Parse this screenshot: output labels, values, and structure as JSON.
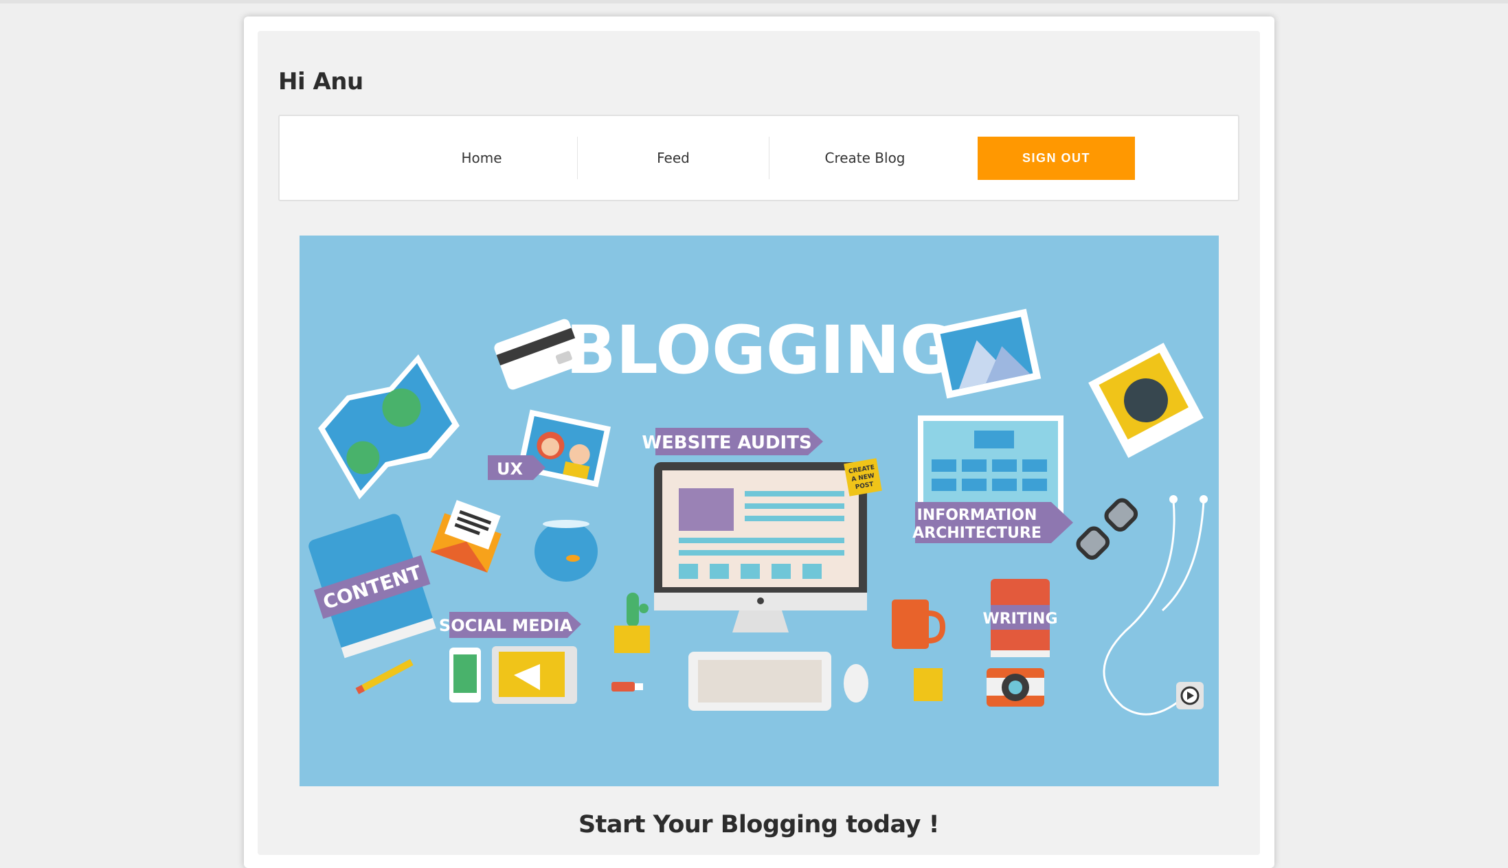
{
  "greeting": "Hi Anu",
  "nav": {
    "home": "Home",
    "feed": "Feed",
    "create_blog": "Create Blog",
    "sign_out": "SIGN OUT"
  },
  "hero": {
    "title": "BLOGGING",
    "labels": {
      "website_audits": "WEBSITE AUDITS",
      "ux": "UX",
      "content": "CONTENT",
      "social_media": "SOCIAL MEDIA",
      "information": "INFORMATION",
      "architecture": "ARCHITECTURE",
      "writing": "WRITING",
      "sticky_line1": "CREATE",
      "sticky_line2": "A NEW",
      "sticky_line3": "POST"
    }
  },
  "tagline": "Start Your Blogging today !",
  "colors": {
    "accent": "#ff9801",
    "hero_background": "#87c5e3",
    "label_purple": "#8e77b0"
  }
}
